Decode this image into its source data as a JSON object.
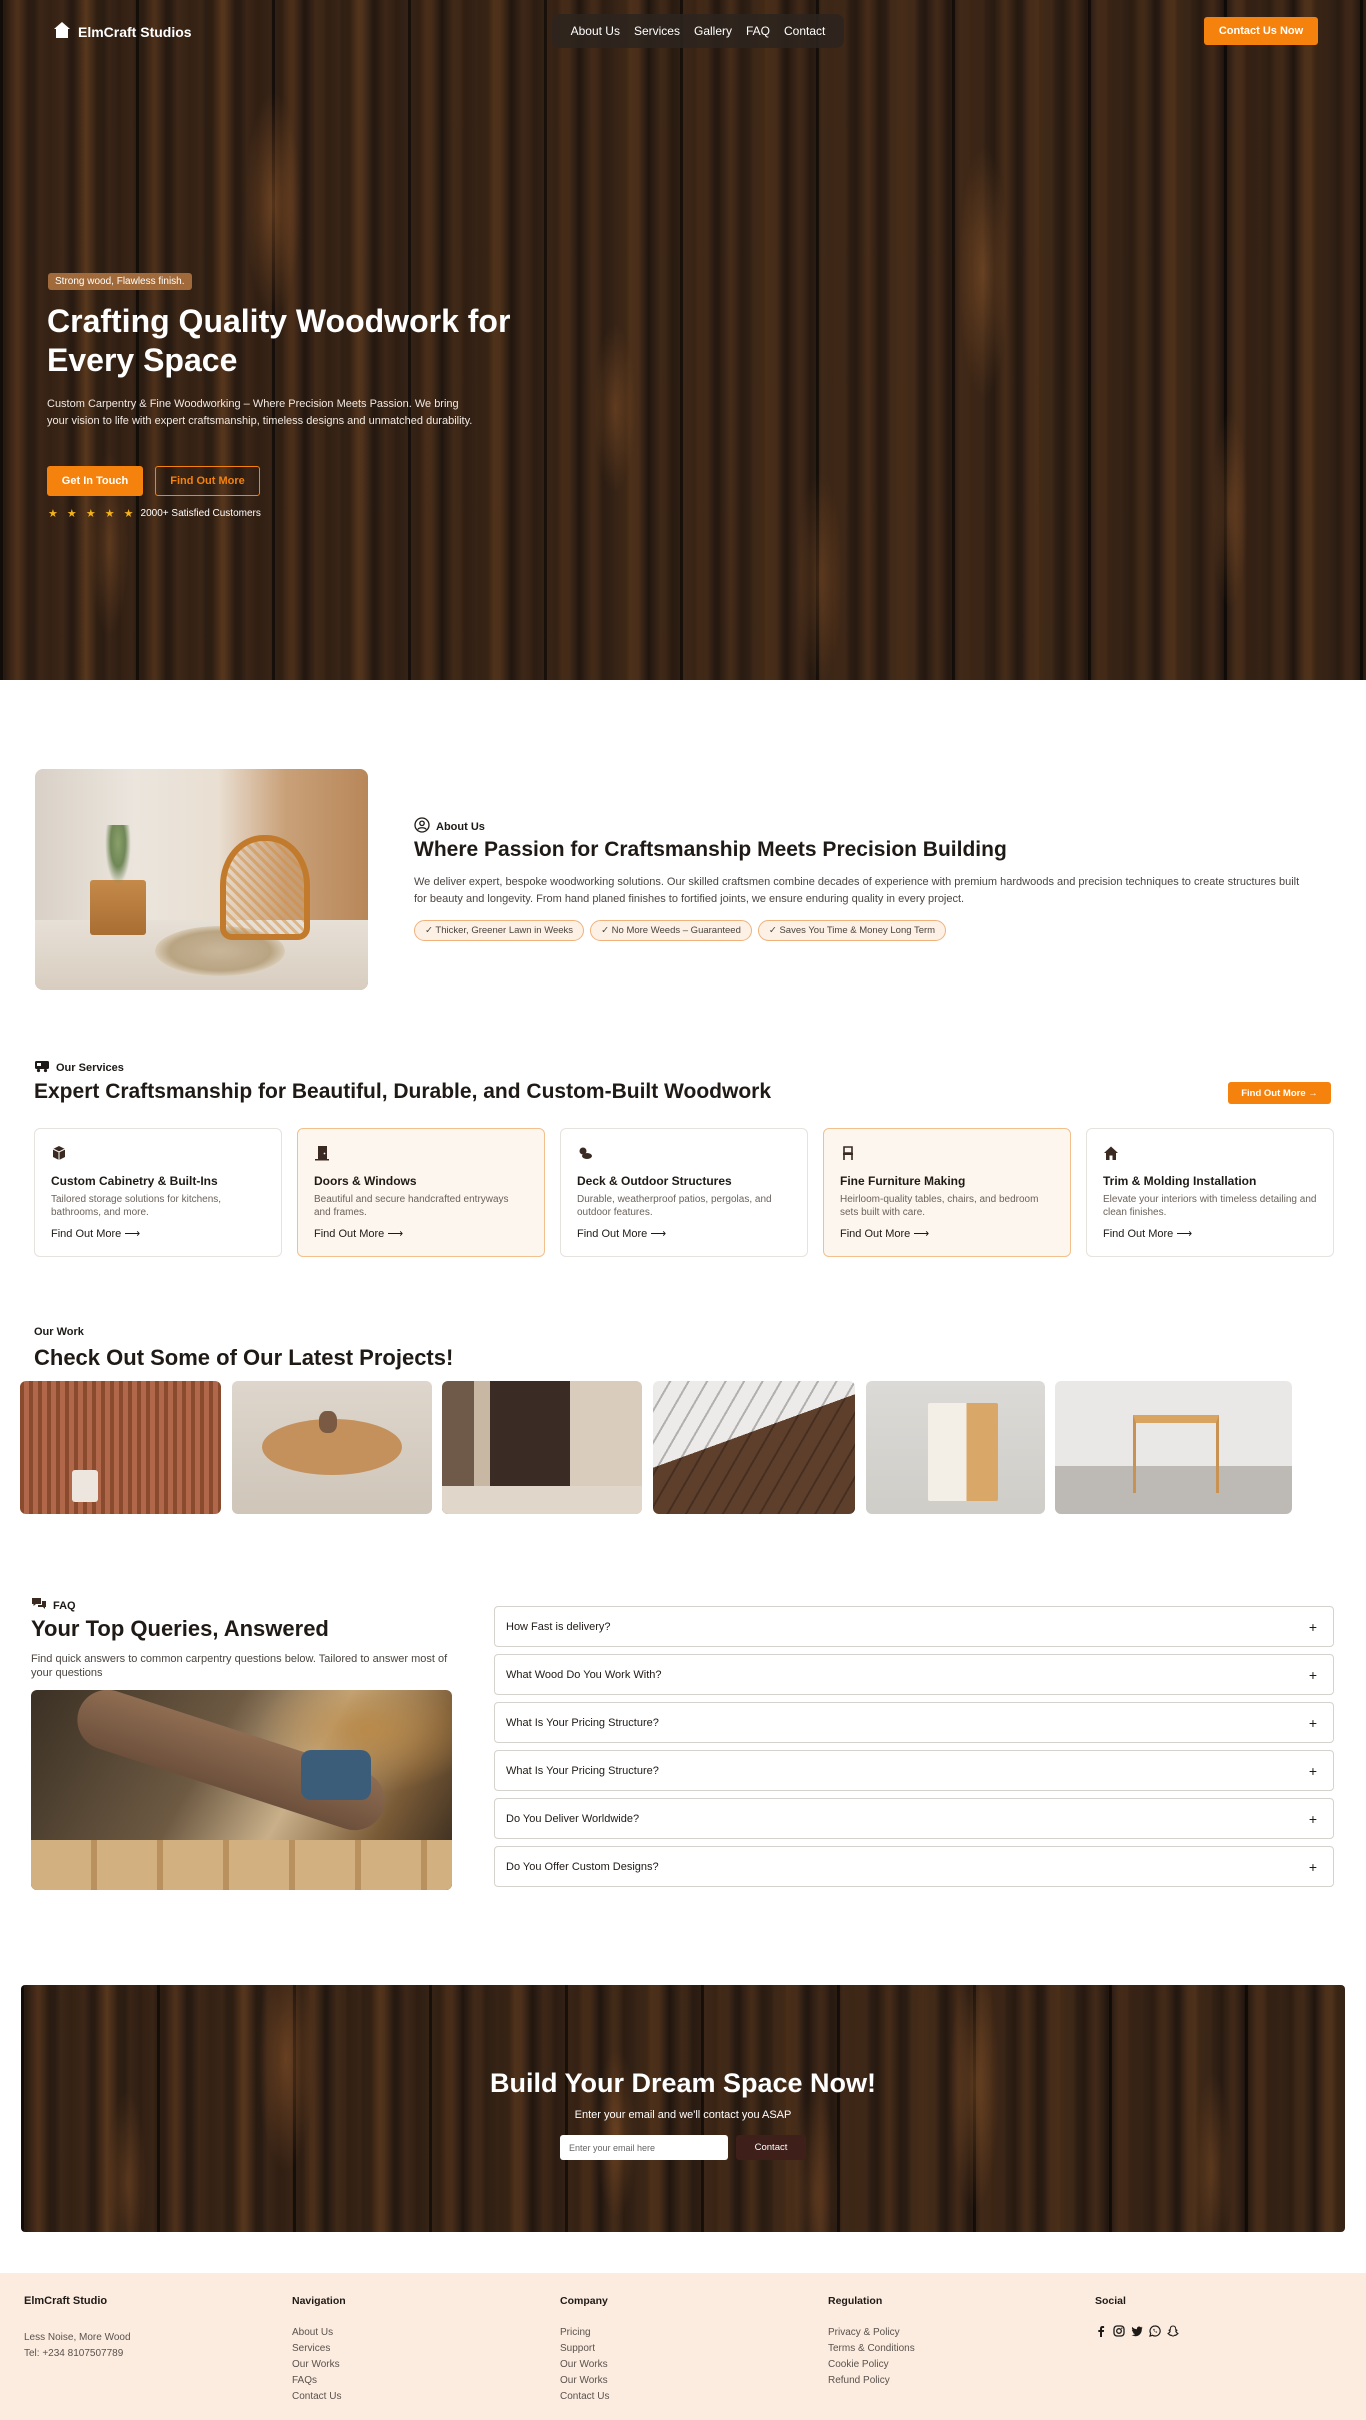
{
  "brand": {
    "name": "ElmCraft Studios",
    "logo_icon": "house-icon"
  },
  "nav": {
    "items": [
      "About Us",
      "Services",
      "Gallery",
      "FAQ",
      "Contact"
    ],
    "cta": "Contact Us Now"
  },
  "hero": {
    "badge": "Strong wood, Flawless finish.",
    "title": "Crafting Quality Woodwork for Every Space",
    "subtitle": "Custom Carpentry & Fine Woodworking – Where Precision Meets Passion. We bring your vision to life with expert craftsmanship, timeless designs and unmatched durability.",
    "primary_button": "Get In Touch",
    "secondary_button": "Find Out More",
    "rating_stars": 5,
    "stars_text": "★ ★ ★ ★ ★",
    "rating_text": "2000+ Satisfied Customers"
  },
  "about": {
    "tag": "About Us",
    "title": "Where Passion for Craftsmanship Meets Precision Building",
    "text": "We deliver expert, bespoke woodworking solutions. Our skilled craftsmen combine decades of experience with premium hardwoods and precision techniques to create structures built for beauty and longevity. From hand planed finishes to fortified joints, we ensure enduring quality in every project.",
    "chips": [
      "✓ Thicker, Greener Lawn in Weeks",
      "✓ No More Weeds – Guaranteed",
      "✓ Saves You Time & Money Long Term"
    ]
  },
  "services": {
    "tag": "Our Services",
    "title": "Expert Craftsmanship for Beautiful, Durable, and Custom-Built Woodwork",
    "cta": "Find Out More →",
    "cards": [
      {
        "icon": "cube-icon",
        "title": "Custom Cabinetry & Built-Ins",
        "text": "Tailored storage solutions for kitchens, bathrooms, and more.",
        "link": "Find Out More ⟶",
        "highlighted": false
      },
      {
        "icon": "door-icon",
        "title": "Doors & Windows",
        "text": "Beautiful and secure handcrafted entryways and frames.",
        "link": "Find Out More ⟶",
        "highlighted": true
      },
      {
        "icon": "sun-cloud-icon",
        "title": "Deck & Outdoor Structures",
        "text": "Durable, weatherproof patios, pergolas, and outdoor features.",
        "link": "Find Out More ⟶",
        "highlighted": false
      },
      {
        "icon": "chair-icon",
        "title": "Fine Furniture Making",
        "text": "Heirloom-quality tables, chairs, and bedroom sets built with care.",
        "link": "Find Out More ⟶",
        "highlighted": true
      },
      {
        "icon": "home-icon",
        "title": "Trim & Molding Installation",
        "text": "Elevate your interiors with timeless detailing and clean finishes.",
        "link": "Find Out More ⟶",
        "highlighted": false
      }
    ]
  },
  "work": {
    "tag": "Our Work",
    "title": "Check Out Some of Our Latest Projects!"
  },
  "faq": {
    "tag": "FAQ",
    "title": "Your Top Queries, Answered",
    "subtitle": "Find quick answers to common carpentry questions below. Tailored to answer most of your questions",
    "items": [
      "How Fast is delivery?",
      "What Wood Do You Work With?",
      "What Is Your Pricing Structure?",
      "What Is Your Pricing Structure?",
      "Do You Deliver Worldwide?",
      "Do You Offer Custom Designs?"
    ],
    "toggle_symbol": "+"
  },
  "banner": {
    "title": "Build Your Dream Space Now!",
    "subtitle": "Enter your email and we'll contact you ASAP",
    "email_placeholder": "Enter your email here",
    "button": "Contact"
  },
  "footer": {
    "brand": {
      "name": "ElmCraft Studio",
      "address": "Less Noise, More Wood",
      "phone": "Tel: +234 8107507789"
    },
    "columns": [
      {
        "title": "Navigation",
        "links": [
          "About Us",
          "Services",
          "Our Works",
          "FAQs",
          "Contact Us"
        ]
      },
      {
        "title": "Company",
        "links": [
          "Pricing",
          "Support",
          "Our Works",
          "Our Works",
          "Contact Us"
        ]
      },
      {
        "title": "Regulation",
        "links": [
          "Privacy & Policy",
          "Terms & Conditions",
          "Cookie Policy",
          "Refund Policy"
        ]
      }
    ],
    "social": {
      "title": "Social",
      "icons": [
        "facebook-icon",
        "instagram-icon",
        "twitter-icon",
        "whatsapp-icon",
        "snapchat-icon"
      ]
    }
  },
  "colors": {
    "accent": "#f5820d",
    "footer_bg": "#fcece0",
    "badge": "#a16a3a",
    "contact_button": "#3e1f1a",
    "chip_border": "#f0b27a"
  }
}
